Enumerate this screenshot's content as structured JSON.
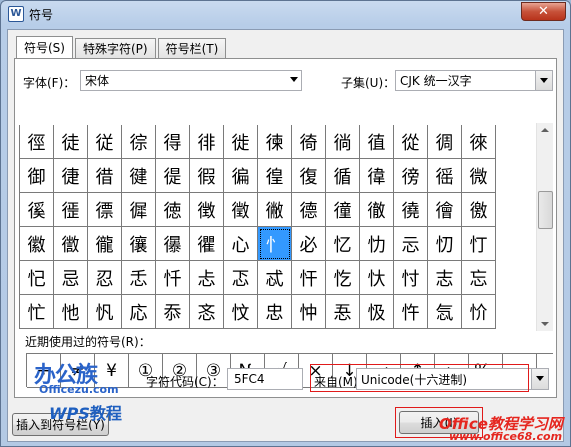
{
  "window": {
    "title": "符号",
    "app_icon": "W",
    "close_glyph": "✕"
  },
  "tabs": [
    {
      "label": "符号(S)",
      "active": true
    },
    {
      "label": "特殊字符(P)",
      "active": false
    },
    {
      "label": "符号栏(T)",
      "active": false
    }
  ],
  "font": {
    "label": "字体(F)：",
    "value": "宋体"
  },
  "subset": {
    "label": "子集(U)：",
    "value": "CJK 统一汉字"
  },
  "grid": {
    "rows": [
      [
        "徑",
        "徒",
        "従",
        "徖",
        "得",
        "徘",
        "徙",
        "徚",
        "徛",
        "徜",
        "徝",
        "從",
        "徟",
        "徠"
      ],
      [
        "御",
        "徢",
        "徣",
        "徤",
        "徥",
        "徦",
        "徧",
        "徨",
        "復",
        "循",
        "徫",
        "徬",
        "徭",
        "微"
      ],
      [
        "徯",
        "徰",
        "徱",
        "徲",
        "徳",
        "徴",
        "徵",
        "徶",
        "德",
        "徸",
        "徹",
        "徺",
        "徻",
        "徼"
      ],
      [
        "徽",
        "徾",
        "徿",
        "忀",
        "忁",
        "忂",
        "心",
        "忄",
        "必",
        "忆",
        "忇",
        "忈",
        "忉",
        "忊"
      ],
      [
        "忋",
        "忌",
        "忍",
        "忎",
        "忏",
        "忐",
        "忑",
        "忒",
        "忓",
        "忔",
        "忕",
        "忖",
        "志",
        "忘"
      ],
      [
        "忙",
        "忚",
        "忛",
        "応",
        "忝",
        "忞",
        "忟",
        "忠",
        "忡",
        "忢",
        "忣",
        "忤",
        "忥",
        "忦"
      ]
    ],
    "selected_row": 3,
    "selected_col": 7
  },
  "recent": {
    "label": "近期使用过的符号(R)：",
    "symbols": [
      "÷",
      "≠",
      "¥",
      "①",
      "②",
      "③",
      "№",
      "√",
      "×",
      "↓",
      "→",
      "↑",
      "←",
      "‰",
      ""
    ]
  },
  "char_code": {
    "label": "字符代码(C)：",
    "value": "5FC4"
  },
  "from": {
    "label": "来自(M)",
    "value": "Unicode(十六进制)"
  },
  "buttons": {
    "insert_to_bar": "插入到符号栏(Y)",
    "insert": "插入(I)"
  },
  "watermarks": {
    "bangong_cn": "办公族",
    "bangong_url": "Officezu.com",
    "wps": "WPS",
    "wps_cn": "教程",
    "office68_cn": "Office教程学习网",
    "office68_url": "www.office68.com"
  }
}
